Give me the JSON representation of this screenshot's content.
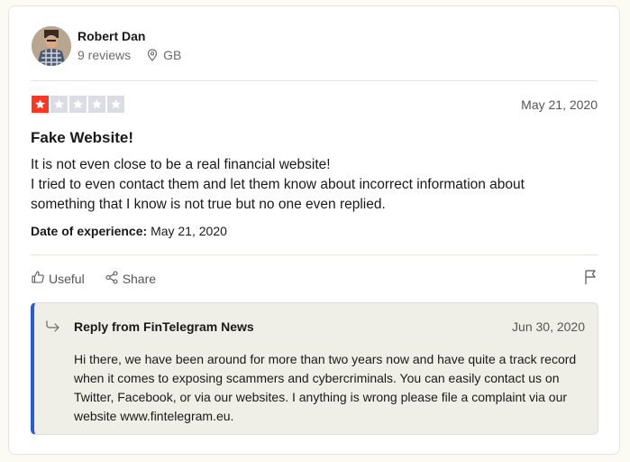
{
  "reviewer": {
    "name": "Robert Dan",
    "reviews": "9 reviews",
    "country": "GB"
  },
  "review": {
    "rating": 1,
    "rating_max": 5,
    "date": "May 21, 2020",
    "title": "Fake Website!",
    "body": "It is not even close to be a real financial website!\nI tried to even contact them and let them know about incorrect information about something that I know is not true but no one even replied.",
    "experience_label": "Date of experience:",
    "experience_date": "May 21, 2020"
  },
  "actions": {
    "useful": "Useful",
    "share": "Share"
  },
  "reply": {
    "from": "Reply from FinTelegram News",
    "date": "Jun 30, 2020",
    "text": "Hi there, we have been around for more than two years now and have quite a track record when it comes to exposing scammers and cybercriminals. You can easily contact us on Twitter, Facebook, or via our websites. I anything is wrong please file a complaint via our website www.fintelegram.eu."
  },
  "colors": {
    "star_on": "#ff3722",
    "star_off": "#dcdce6",
    "reply_accent": "#2a5bd7"
  },
  "icons": [
    "pin-icon",
    "star-icon",
    "thumbs-up-icon",
    "share-icon",
    "flag-icon",
    "reply-arrow-icon"
  ]
}
